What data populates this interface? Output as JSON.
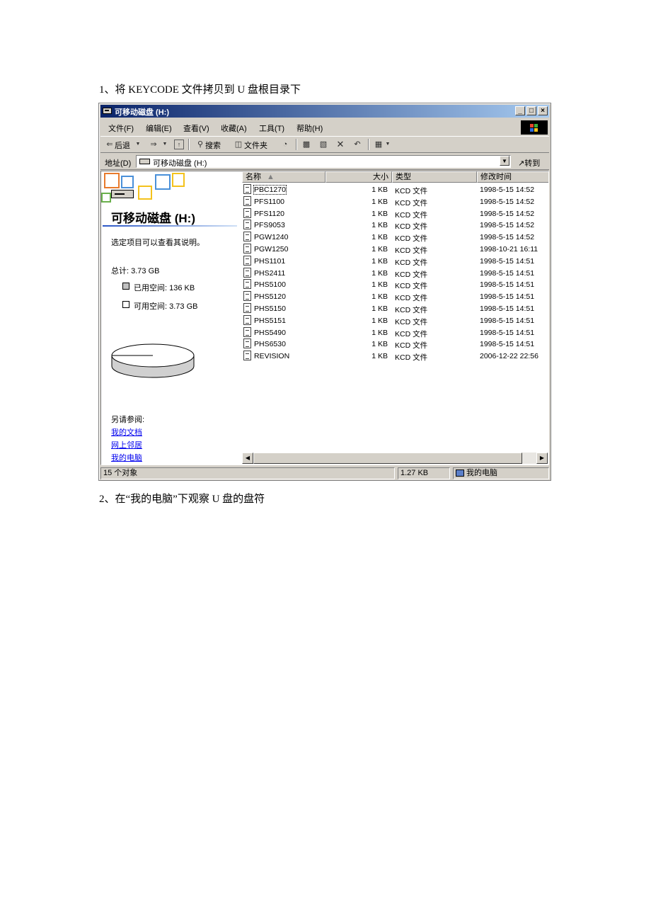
{
  "document": {
    "step1": "1、将 KEYCODE 文件拷贝到 U 盘根目录下",
    "step2": "2、在“我的电脑”下观察 U 盘的盘符"
  },
  "window": {
    "title": "可移动磁盘 (H:)",
    "caption_buttons": {
      "minimize": "_",
      "maximize": "□",
      "close": "×"
    }
  },
  "menu": {
    "file": "文件(F)",
    "edit": "编辑(E)",
    "view": "查看(V)",
    "favorites": "收藏(A)",
    "tools": "工具(T)",
    "help": "帮助(H)"
  },
  "toolbar": {
    "back": "后退",
    "search": "搜索",
    "folders": "文件夹",
    "icons": [
      "back-arrow-icon",
      "forward-arrow-icon",
      "up-folder-icon",
      "search-icon",
      "folders-icon",
      "history-icon",
      "move-to-icon",
      "copy-to-icon",
      "delete-icon",
      "undo-icon",
      "views-icon"
    ]
  },
  "address": {
    "label": "地址(D)",
    "value": "可移动磁盘 (H:)",
    "go": "转到"
  },
  "left_pane": {
    "title": "可移动磁盘 (H:)",
    "hint": "选定项目可以查看其说明。",
    "total": "总计: 3.73 GB",
    "used": "已用空间: 136 KB",
    "free": "可用空间: 3.73 GB",
    "see_also": "另请参阅:",
    "links": [
      "我的文档",
      "网上邻居",
      "我的电脑"
    ],
    "used_fraction": 3.48e-05,
    "colors": {
      "used": "#c0c0c0",
      "free": "#ffffff",
      "link": "#0000ee"
    }
  },
  "file_list": {
    "columns": {
      "name": "名称",
      "size": "大小",
      "type": "类型",
      "modified": "修改时间"
    },
    "rows": [
      {
        "name": "PBC1270",
        "size": "1 KB",
        "type": "KCD 文件",
        "modified": "1998-5-15 14:52"
      },
      {
        "name": "PFS1100",
        "size": "1 KB",
        "type": "KCD 文件",
        "modified": "1998-5-15 14:52"
      },
      {
        "name": "PFS1120",
        "size": "1 KB",
        "type": "KCD 文件",
        "modified": "1998-5-15 14:52"
      },
      {
        "name": "PFS9053",
        "size": "1 KB",
        "type": "KCD 文件",
        "modified": "1998-5-15 14:52"
      },
      {
        "name": "PGW1240",
        "size": "1 KB",
        "type": "KCD 文件",
        "modified": "1998-5-15 14:52"
      },
      {
        "name": "PGW1250",
        "size": "1 KB",
        "type": "KCD 文件",
        "modified": "1998-10-21 16:11"
      },
      {
        "name": "PHS1101",
        "size": "1 KB",
        "type": "KCD 文件",
        "modified": "1998-5-15 14:51"
      },
      {
        "name": "PHS2411",
        "size": "1 KB",
        "type": "KCD 文件",
        "modified": "1998-5-15 14:51"
      },
      {
        "name": "PHS5100",
        "size": "1 KB",
        "type": "KCD 文件",
        "modified": "1998-5-15 14:51"
      },
      {
        "name": "PHS5120",
        "size": "1 KB",
        "type": "KCD 文件",
        "modified": "1998-5-15 14:51"
      },
      {
        "name": "PHS5150",
        "size": "1 KB",
        "type": "KCD 文件",
        "modified": "1998-5-15 14:51"
      },
      {
        "name": "PHS5151",
        "size": "1 KB",
        "type": "KCD 文件",
        "modified": "1998-5-15 14:51"
      },
      {
        "name": "PHS5490",
        "size": "1 KB",
        "type": "KCD 文件",
        "modified": "1998-5-15 14:51"
      },
      {
        "name": "PHS6530",
        "size": "1 KB",
        "type": "KCD 文件",
        "modified": "1998-5-15 14:51"
      },
      {
        "name": "REVISION",
        "size": "1 KB",
        "type": "KCD 文件",
        "modified": "2006-12-22 22:56"
      }
    ]
  },
  "status": {
    "count": "15 个对象",
    "size": "1.27 KB",
    "zone": "我的电脑"
  }
}
